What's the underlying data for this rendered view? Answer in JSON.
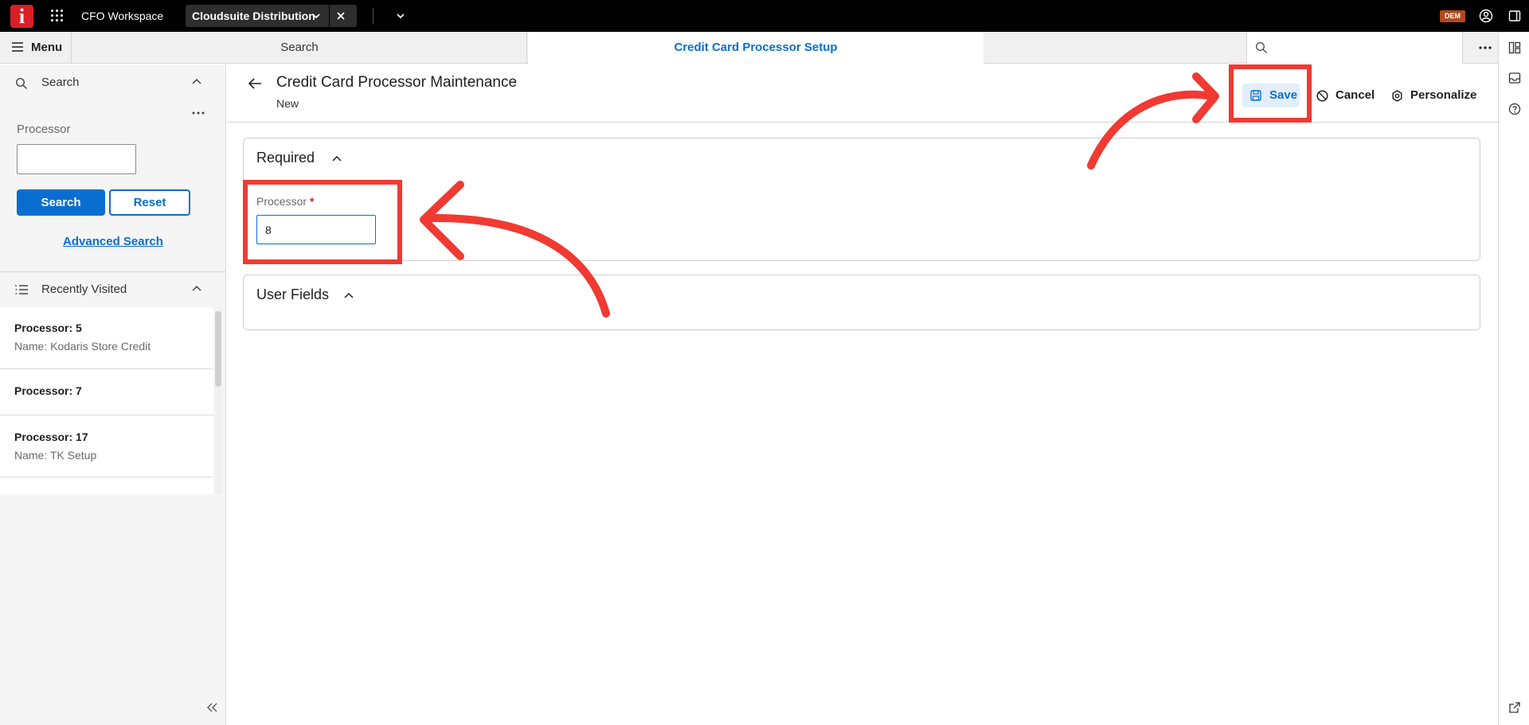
{
  "topbar": {
    "logo": "i",
    "workspace": "CFO Workspace",
    "tab_label": "Cloudsuite Distribution",
    "user_badge": "DEM"
  },
  "navbar": {
    "menu_label": "Menu",
    "search_tab": "Search",
    "active_tab": "Credit Card Processor Setup",
    "global_search_placeholder": ""
  },
  "sidebar": {
    "search_header": "Search",
    "processor_label": "Processor",
    "processor_value": "",
    "search_button": "Search",
    "reset_button": "Reset",
    "advanced_search": "Advanced Search",
    "recent_header": "Recently Visited",
    "recent_items": [
      {
        "title": "Processor: 5",
        "subtitle": "Name: Kodaris Store Credit"
      },
      {
        "title": "Processor: 7",
        "subtitle": ""
      },
      {
        "title": "Processor: 17",
        "subtitle": "Name: TK Setup"
      }
    ]
  },
  "main": {
    "title": "Credit Card Processor Maintenance",
    "subtitle": "New",
    "toolbar": {
      "save": "Save",
      "cancel": "Cancel",
      "personalize": "Personalize"
    },
    "sections": {
      "required": {
        "title": "Required",
        "processor_label": "Processor",
        "required_marker": "*",
        "processor_value": "8"
      },
      "user_fields": {
        "title": "User Fields"
      }
    }
  },
  "colors": {
    "accent": "#0a6ed1",
    "annotation": "#f03a32",
    "logo": "#da1f26",
    "badge": "#b2481b"
  }
}
